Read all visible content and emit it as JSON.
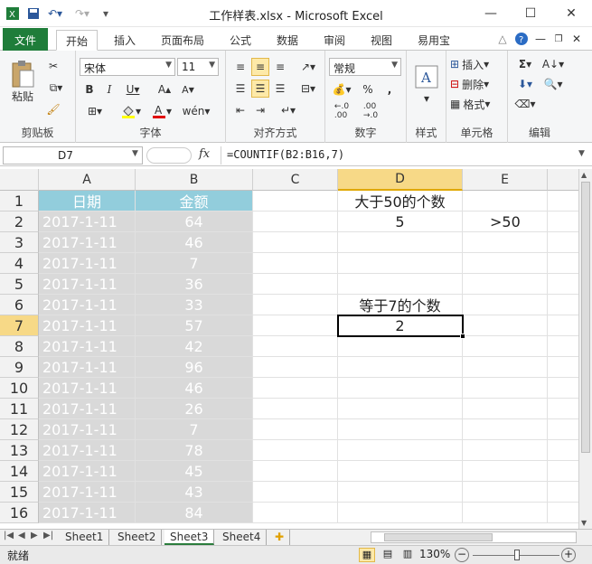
{
  "window": {
    "title": "工作样表.xlsx - Microsoft Excel"
  },
  "tabs": [
    "文件",
    "开始",
    "插入",
    "页面布局",
    "公式",
    "数据",
    "审阅",
    "视图",
    "易用宝"
  ],
  "ribbon": {
    "clipboard": {
      "paste": "粘贴",
      "label": "剪贴板"
    },
    "font": {
      "name": "宋体",
      "size": "11",
      "label": "字体"
    },
    "alignment": {
      "label": "对齐方式"
    },
    "number": {
      "format": "常规",
      "label": "数字"
    },
    "styles": {
      "label": "样式"
    },
    "cells": {
      "insert": "插入",
      "delete": "删除",
      "format": "格式",
      "label": "单元格"
    },
    "editing": {
      "label": "编辑"
    }
  },
  "formula_bar": {
    "name_box": "D7",
    "formula": "=COUNTIF(B2:B16,7)"
  },
  "columns": [
    "A",
    "B",
    "C",
    "D",
    "E"
  ],
  "rows": [
    "1",
    "2",
    "3",
    "4",
    "5",
    "6",
    "7",
    "8",
    "9",
    "10",
    "11",
    "12",
    "13",
    "14",
    "15",
    "16"
  ],
  "table": {
    "headers": [
      "日期",
      "金额"
    ],
    "dates": [
      "2017-1-11",
      "2017-1-11",
      "2017-1-11",
      "2017-1-11",
      "2017-1-11",
      "2017-1-11",
      "2017-1-11",
      "2017-1-11",
      "2017-1-11",
      "2017-1-11",
      "2017-1-11",
      "2017-1-11",
      "2017-1-11",
      "2017-1-11",
      "2017-1-11"
    ],
    "amounts": [
      "64",
      "46",
      "7",
      "36",
      "33",
      "57",
      "42",
      "96",
      "46",
      "26",
      "7",
      "78",
      "45",
      "43",
      "84"
    ]
  },
  "cells": {
    "D1": "大于50的个数",
    "D2": "5",
    "E2": ">50",
    "D6": "等于7的个数",
    "D7": "2"
  },
  "sheets": [
    "Sheet1",
    "Sheet2",
    "Sheet3",
    "Sheet4"
  ],
  "active_sheet": "Sheet3",
  "status": {
    "mode": "就绪",
    "zoom": "130%"
  }
}
